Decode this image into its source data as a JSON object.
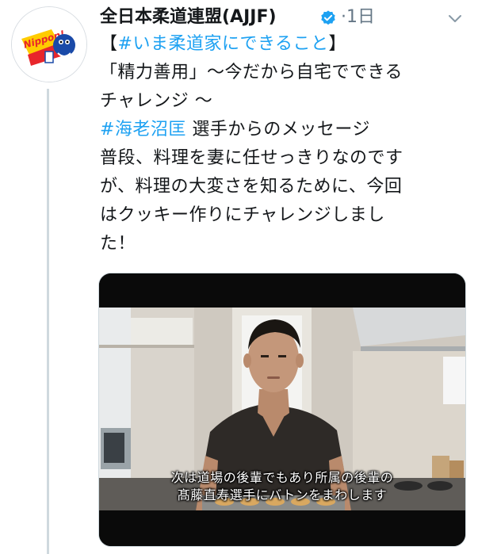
{
  "tweet": {
    "author_name": "全日本柔道連盟(AJJF)",
    "time": "·1日",
    "avatar_logo_text": "Nippon!",
    "text_lines": [
      {
        "parts": [
          {
            "t": "【",
            "hl": false
          },
          {
            "t": "#いま柔道家にできること",
            "hl": true
          },
          {
            "t": "】",
            "hl": false
          }
        ]
      },
      {
        "parts": [
          {
            "t": "「精力善用」〜今だから自宅でできる",
            "hl": false
          }
        ]
      },
      {
        "parts": [
          {
            "t": "チャレンジ 〜",
            "hl": false
          }
        ]
      },
      {
        "parts": [
          {
            "t": "#海老沼匡",
            "hl": true
          },
          {
            "t": " 選手からのメッセージ",
            "hl": false
          }
        ]
      },
      {
        "parts": [
          {
            "t": "普段、料理を妻に任せっきりなのです",
            "hl": false
          }
        ]
      },
      {
        "parts": [
          {
            "t": "が、料理の大変さを知るために、今回",
            "hl": false
          }
        ]
      },
      {
        "parts": [
          {
            "t": "はクッキー作りにチャレンジしまし",
            "hl": false
          }
        ]
      },
      {
        "parts": [
          {
            "t": "た！",
            "hl": false
          }
        ]
      }
    ],
    "video": {
      "caption_line1": "次は道場の後輩でもあり所属の後輩の",
      "caption_line2": "髙藤直寿選手にバトンをまわします"
    }
  },
  "colors": {
    "link": "#1da1f2",
    "verified": "#1da1f2",
    "muted": "#657786"
  },
  "icons": {
    "verified": "verified-badge-icon",
    "menu": "chevron-down-icon"
  }
}
